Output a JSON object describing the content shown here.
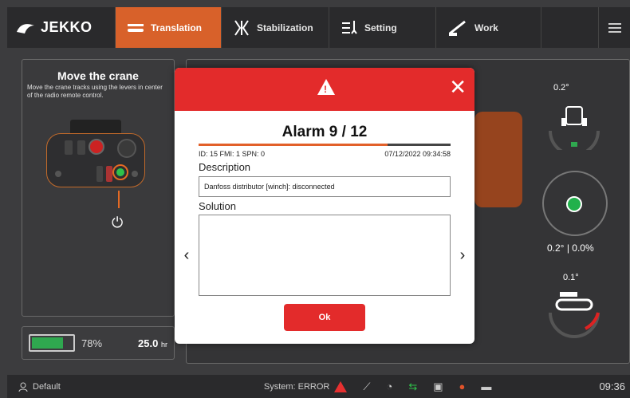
{
  "app": {
    "brand": "JEKKO"
  },
  "tabs": [
    {
      "label": "Translation",
      "icon": "tracks-icon",
      "active": true
    },
    {
      "label": "Stabilization",
      "icon": "stabilizer-icon",
      "active": false
    },
    {
      "label": "Setting",
      "icon": "sliders-icon",
      "active": false
    },
    {
      "label": "Work",
      "icon": "boom-icon",
      "active": false
    }
  ],
  "left_panel": {
    "title": "Move the crane",
    "description": "Move the crane tracks using the levers in center of the radio remote control."
  },
  "battery": {
    "percent": "78%",
    "level": 0.78,
    "hours": "25.0",
    "hours_unit": "hr"
  },
  "indicators": {
    "tilt_top": "0.2°",
    "level_readout": "0.2° | 0.0%",
    "tilt_bottom": "0.1°"
  },
  "modal": {
    "title": "Alarm 9 / 12",
    "progress": 0.75,
    "codes": "ID: 15  FMI: 1  SPN: 0",
    "datetime": "07/12/2022 09:34:58",
    "description_label": "Description",
    "description_value": "Danfoss distributor [winch]: disconnected",
    "solution_label": "Solution",
    "solution_value": "",
    "ok_label": "Ok",
    "close_glyph": "✕",
    "prev_glyph": "‹",
    "next_glyph": "›"
  },
  "status_bar": {
    "user": "Default",
    "system": "System: ERROR",
    "time": "09:36"
  },
  "colors": {
    "accent": "#d8612a",
    "alarm": "#e32b2b",
    "ok": "#2fa84f"
  }
}
